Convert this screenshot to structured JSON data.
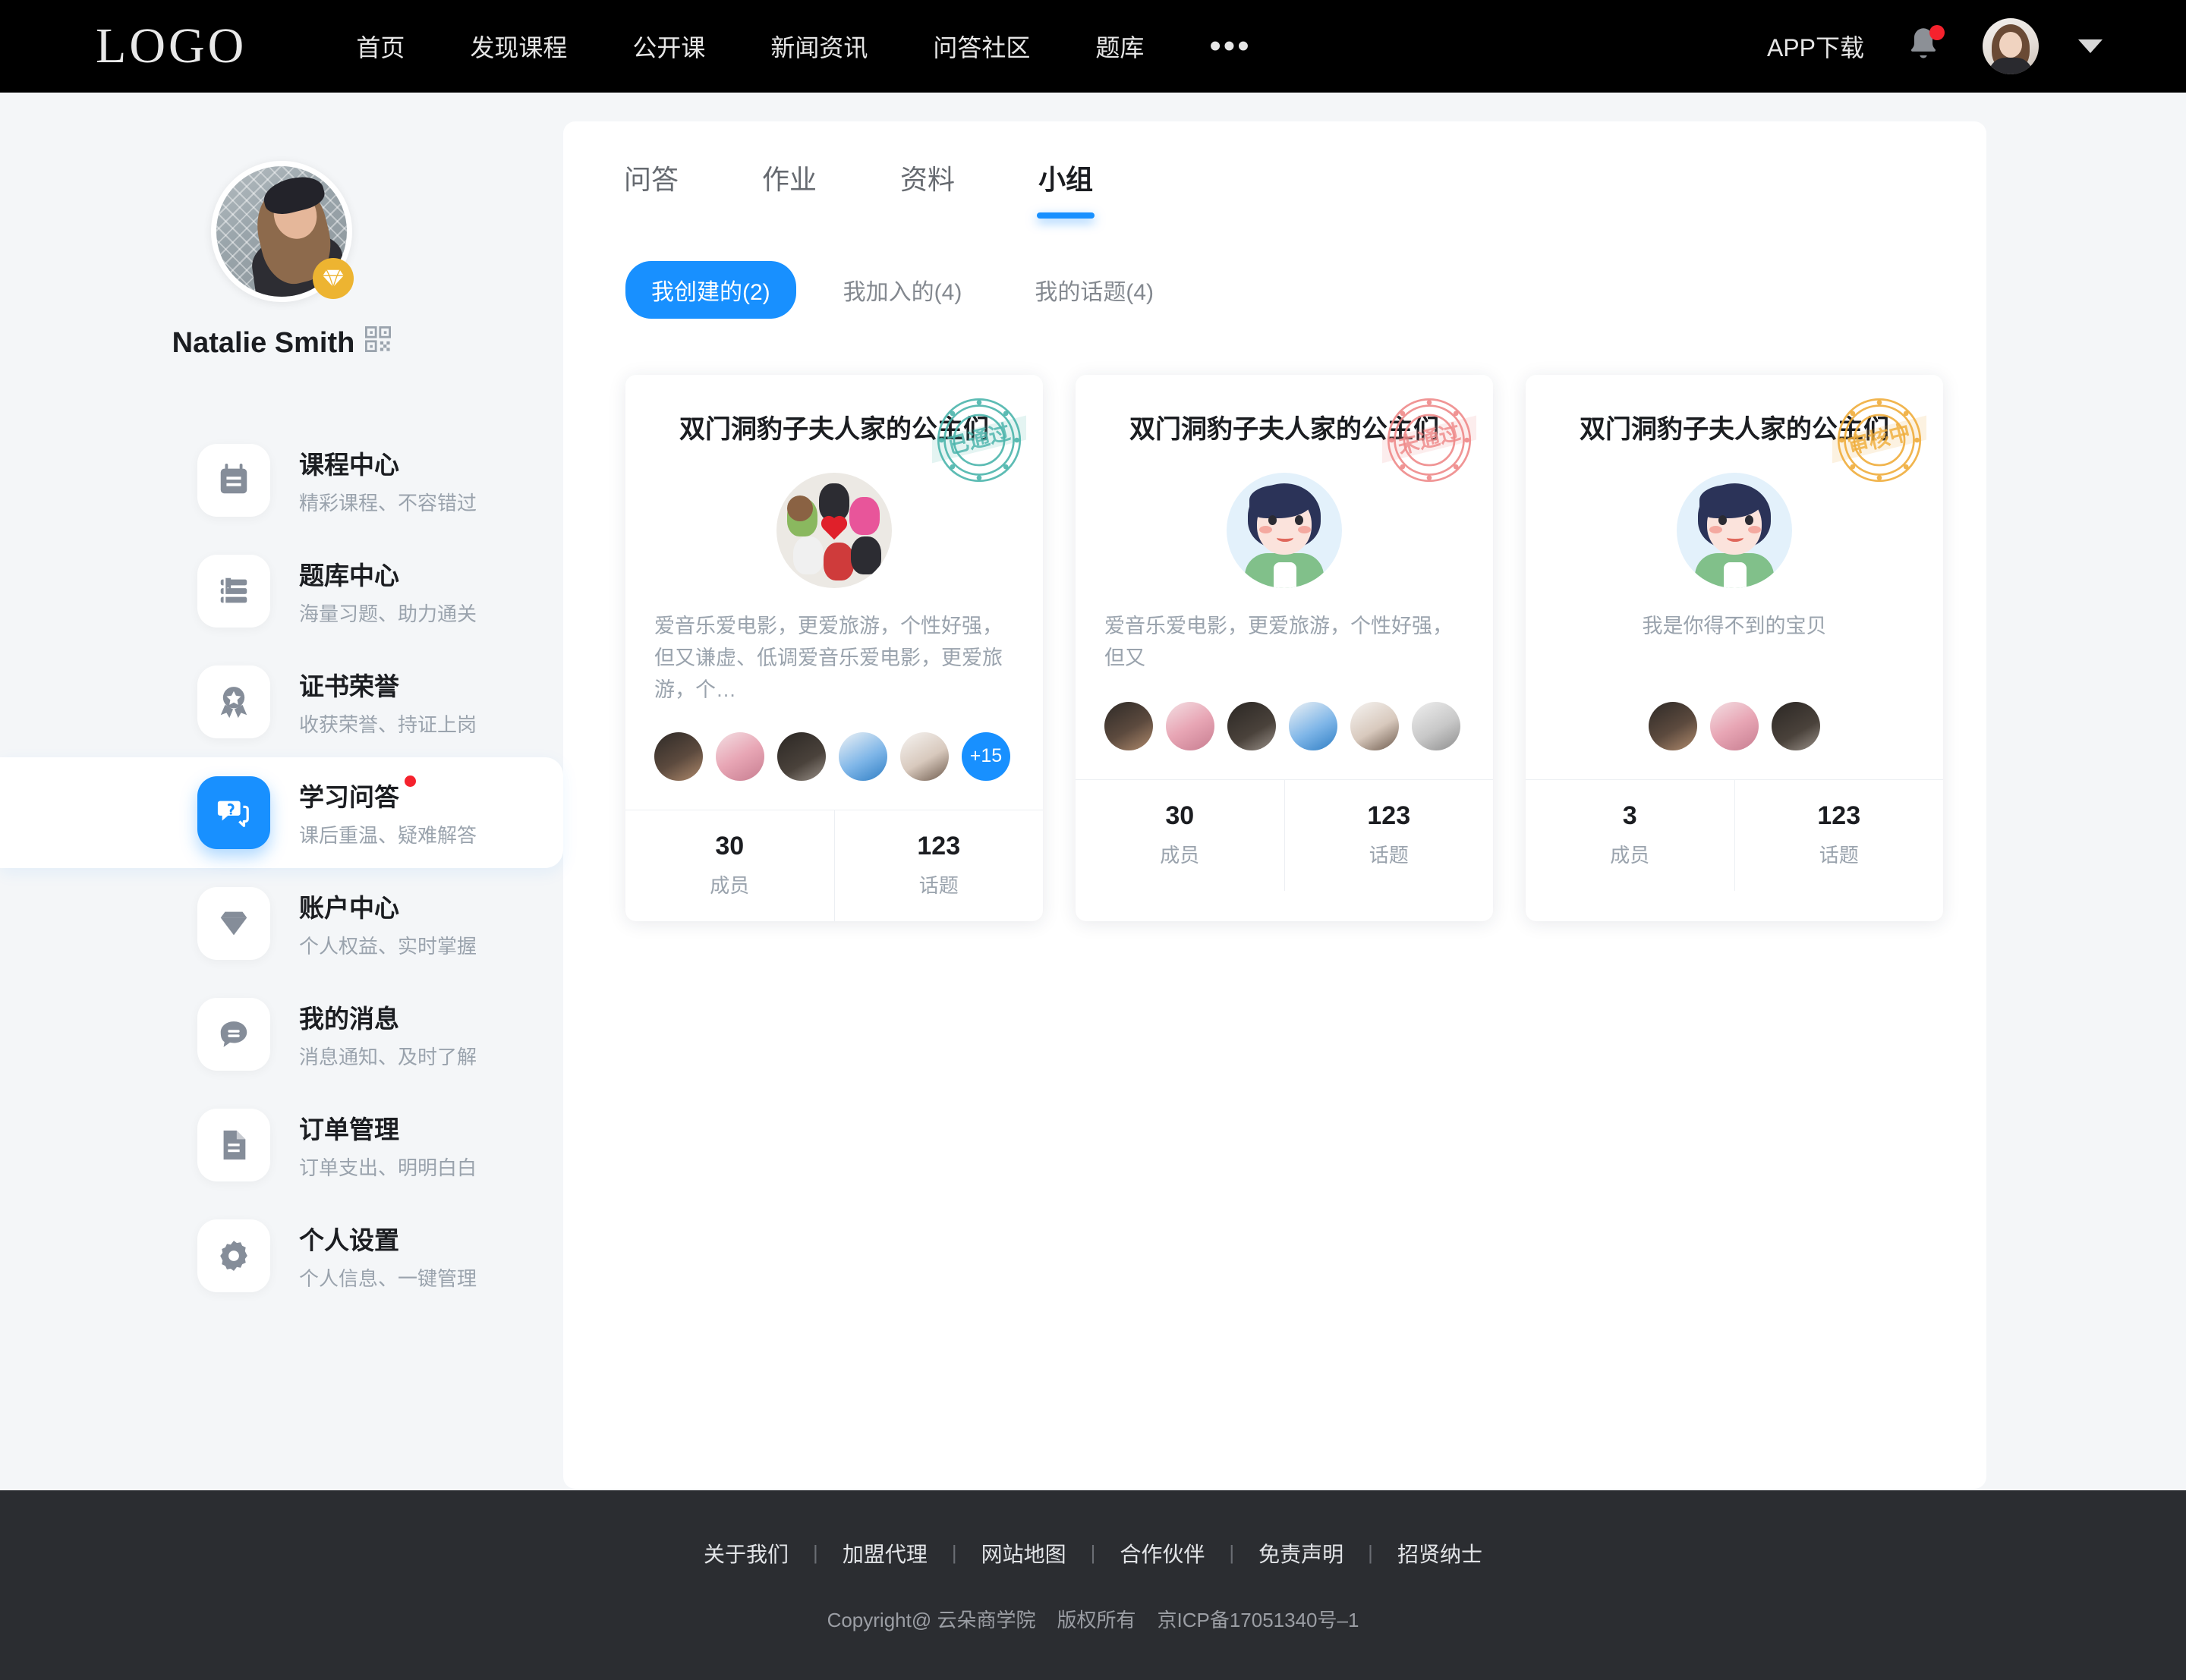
{
  "header": {
    "logo": "LOGO",
    "nav": [
      {
        "label": "首页"
      },
      {
        "label": "发现课程"
      },
      {
        "label": "公开课"
      },
      {
        "label": "新闻资讯"
      },
      {
        "label": "问答社区"
      },
      {
        "label": "题库"
      }
    ],
    "more_icon": "ellipsis-icon",
    "app_download": "APP下载",
    "bell_icon": "bell-icon",
    "has_notification": true,
    "avatar_icon": "user-avatar",
    "chevron_icon": "chevron-down-icon"
  },
  "sidebar": {
    "user_name": "Natalie Smith",
    "qr_icon": "qr-code-icon",
    "vip_icon": "diamond-badge-icon",
    "items": [
      {
        "title": "课程中心",
        "sub": "精彩课程、不容错过",
        "icon": "calendar-icon",
        "active": false,
        "dot": false
      },
      {
        "title": "题库中心",
        "sub": "海量习题、助力通关",
        "icon": "book-list-icon",
        "active": false,
        "dot": false
      },
      {
        "title": "证书荣誉",
        "sub": "收获荣誉、持证上岗",
        "icon": "medal-icon",
        "active": false,
        "dot": false
      },
      {
        "title": "学习问答",
        "sub": "课后重温、疑难解答",
        "icon": "question-chat-icon",
        "active": true,
        "dot": true
      },
      {
        "title": "账户中心",
        "sub": "个人权益、实时掌握",
        "icon": "diamond-icon",
        "active": false,
        "dot": false
      },
      {
        "title": "我的消息",
        "sub": "消息通知、及时了解",
        "icon": "message-icon",
        "active": false,
        "dot": false
      },
      {
        "title": "订单管理",
        "sub": "订单支出、明明白白",
        "icon": "document-icon",
        "active": false,
        "dot": false
      },
      {
        "title": "个人设置",
        "sub": "个人信息、一键管理",
        "icon": "gear-icon",
        "active": false,
        "dot": false
      }
    ]
  },
  "main": {
    "tabs": [
      {
        "label": "问答",
        "active": false
      },
      {
        "label": "作业",
        "active": false
      },
      {
        "label": "资料",
        "active": false
      },
      {
        "label": "小组",
        "active": true
      }
    ],
    "filters": [
      {
        "label": "我创建的(2)",
        "active": true
      },
      {
        "label": "我加入的(4)",
        "active": false
      },
      {
        "label": "我的话题(4)",
        "active": false
      }
    ],
    "cards": [
      {
        "title": "双门洞豹子夫人家的公主们",
        "stamp_text": "已通过",
        "stamp_color": "#4cb5ac",
        "stamp_icon": "approved-stamp-icon",
        "avatar_kind": "group-photo",
        "desc": "爱音乐爱电影，更爱旅游，个性好强，但又谦虚、低调爱音乐爱电影，更爱旅游，个…",
        "desc_align": "left",
        "member_count_more": "+15",
        "members_shown": 5,
        "members_centered": false,
        "stats": [
          {
            "num": "30",
            "label": "成员"
          },
          {
            "num": "123",
            "label": "话题"
          }
        ]
      },
      {
        "title": "双门洞豹子夫人家的公主们",
        "stamp_text": "未通过",
        "stamp_color": "#ef8a8a",
        "stamp_icon": "rejected-stamp-icon",
        "avatar_kind": "cartoon",
        "desc": "爱音乐爱电影，更爱旅游，个性好强，但又",
        "desc_align": "left",
        "member_count_more": "",
        "members_shown": 6,
        "members_centered": false,
        "stats": [
          {
            "num": "30",
            "label": "成员"
          },
          {
            "num": "123",
            "label": "话题"
          }
        ]
      },
      {
        "title": "双门洞豹子夫人家的公主们",
        "stamp_text": "审核中",
        "stamp_color": "#f0ae3c",
        "stamp_icon": "pending-stamp-icon",
        "avatar_kind": "cartoon",
        "desc": "我是你得不到的宝贝",
        "desc_align": "center",
        "member_count_more": "",
        "members_shown": 3,
        "members_centered": true,
        "stats": [
          {
            "num": "3",
            "label": "成员"
          },
          {
            "num": "123",
            "label": "话题"
          }
        ]
      }
    ]
  },
  "footer": {
    "links": [
      "关于我们",
      "加盟代理",
      "网站地图",
      "合作伙伴",
      "免责声明",
      "招贤纳士"
    ],
    "copyright": "Copyright@ 云朵商学院",
    "rights": "版权所有",
    "icp": "京ICP备17051340号–1"
  },
  "colors": {
    "accent": "#1890ff",
    "header_bg": "#000000",
    "page_bg": "#f4f6f8",
    "footer_bg": "#2b2d31",
    "danger": "#f5222d",
    "vip_gold": "#edb431"
  }
}
